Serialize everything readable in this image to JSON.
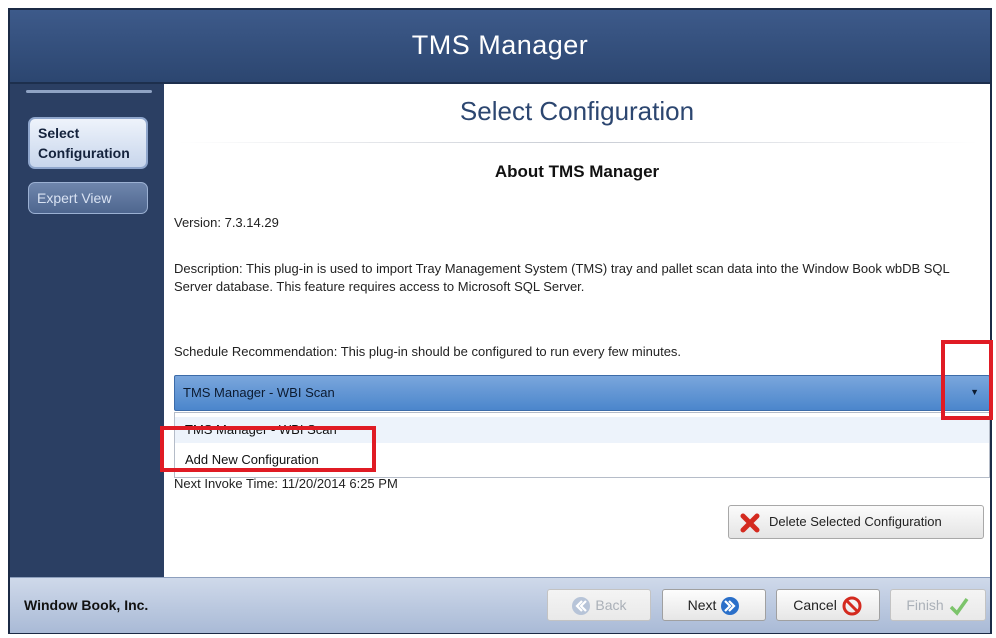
{
  "window": {
    "title": "TMS Manager"
  },
  "sidebar": {
    "items": [
      {
        "label": "Select Configuration",
        "active": true
      },
      {
        "label": "Expert View",
        "active": false
      }
    ]
  },
  "main": {
    "section_title": "Select Configuration",
    "about_heading": "About TMS Manager",
    "version": "Version: 7.3.14.29",
    "description": "Description: This plug-in is used to import Tray Management System (TMS) tray and pallet scan data into the Window Book wbDB SQL Server database. This feature requires access to Microsoft SQL Server.",
    "schedule": "Schedule Recommendation: This plug-in should be configured to run every few minutes.",
    "config_select": {
      "selected": "TMS Manager - WBI Scan",
      "options": [
        "TMS Manager - WBI Scan",
        "Add New Configuration"
      ]
    },
    "next_invoke_partial": "Next Invoke Time:  11/20/2014 6:25 PM",
    "delete_button": "Delete Selected Configuration"
  },
  "footer": {
    "company": "Window Book, Inc.",
    "back": "Back",
    "next": "Next",
    "cancel": "Cancel",
    "finish": "Finish"
  },
  "colors": {
    "title_bar": "#2c4670",
    "sidebar": "#2b3f63",
    "combo": "#5b92d4",
    "highlight": "#e01b24"
  },
  "icons": [
    "delete-x-icon",
    "back-arrow-icon",
    "next-arrow-icon",
    "cancel-icon",
    "checkmark-icon",
    "dropdown-arrow-icon"
  ]
}
